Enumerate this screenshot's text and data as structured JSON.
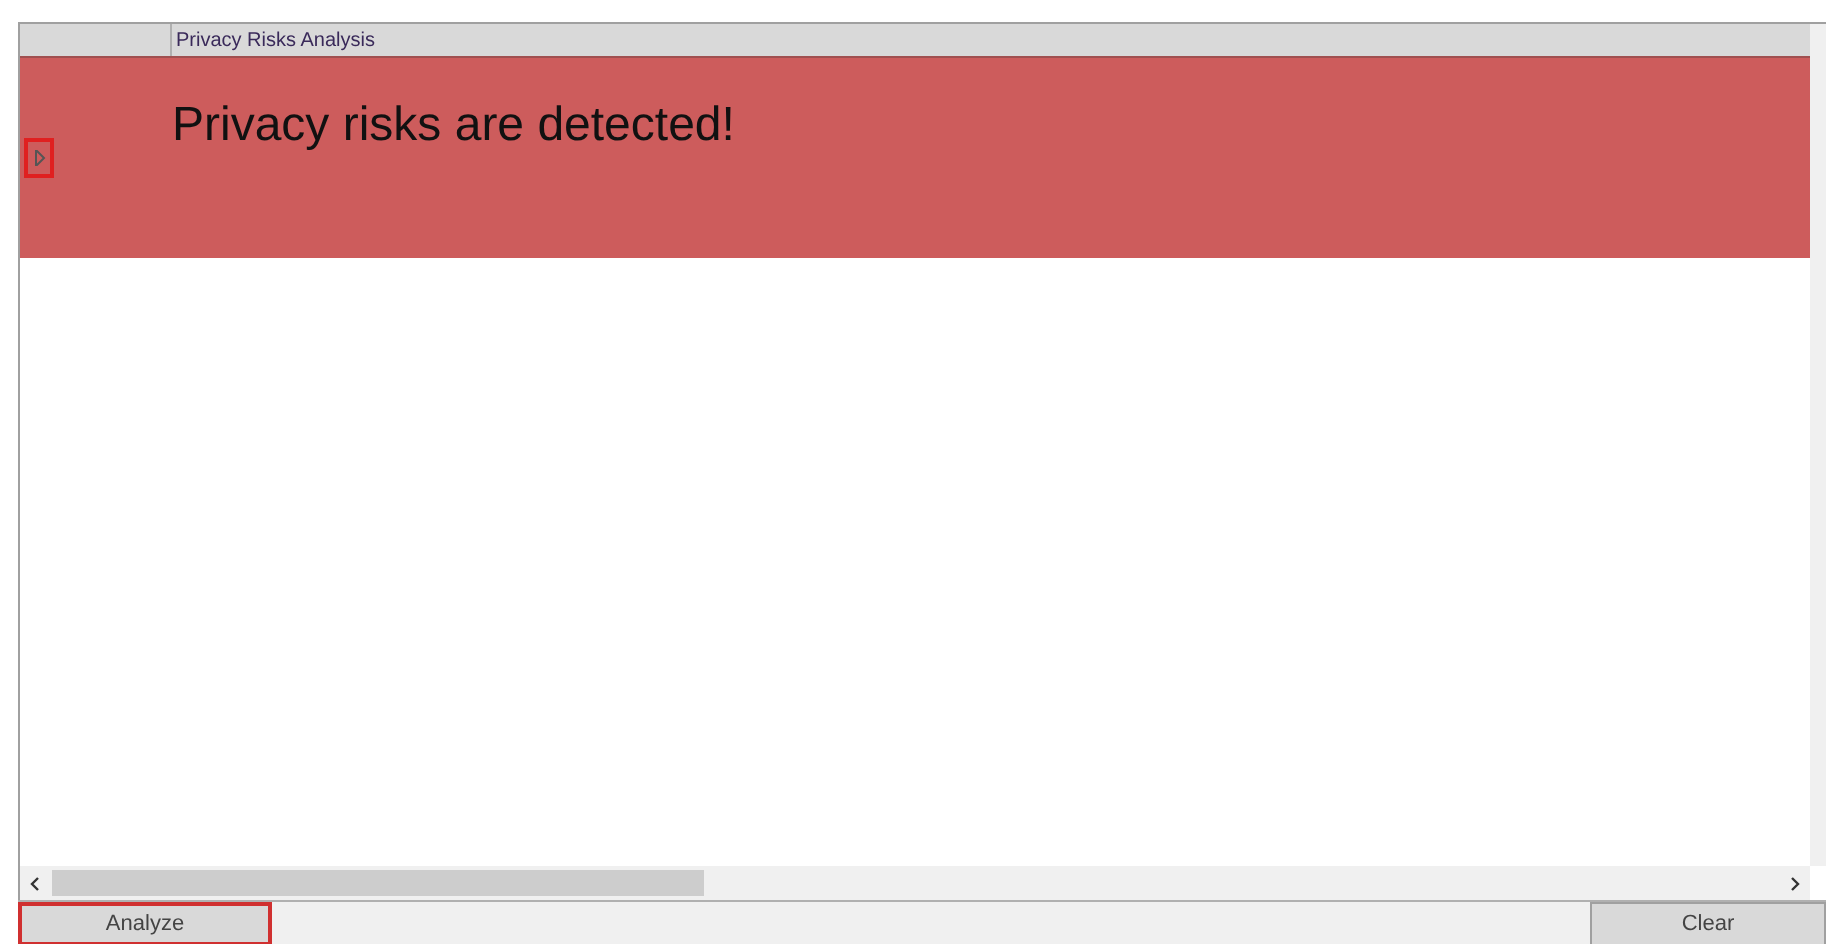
{
  "grid": {
    "columns": [
      "Privacy Risks Analysis"
    ],
    "rows": [
      {
        "text": "Privacy risks are detected!",
        "highlighted": true
      }
    ]
  },
  "buttons": [
    {
      "label": "Analyze",
      "highlighted": true
    },
    {
      "label": "Clear",
      "highlighted": false
    }
  ]
}
